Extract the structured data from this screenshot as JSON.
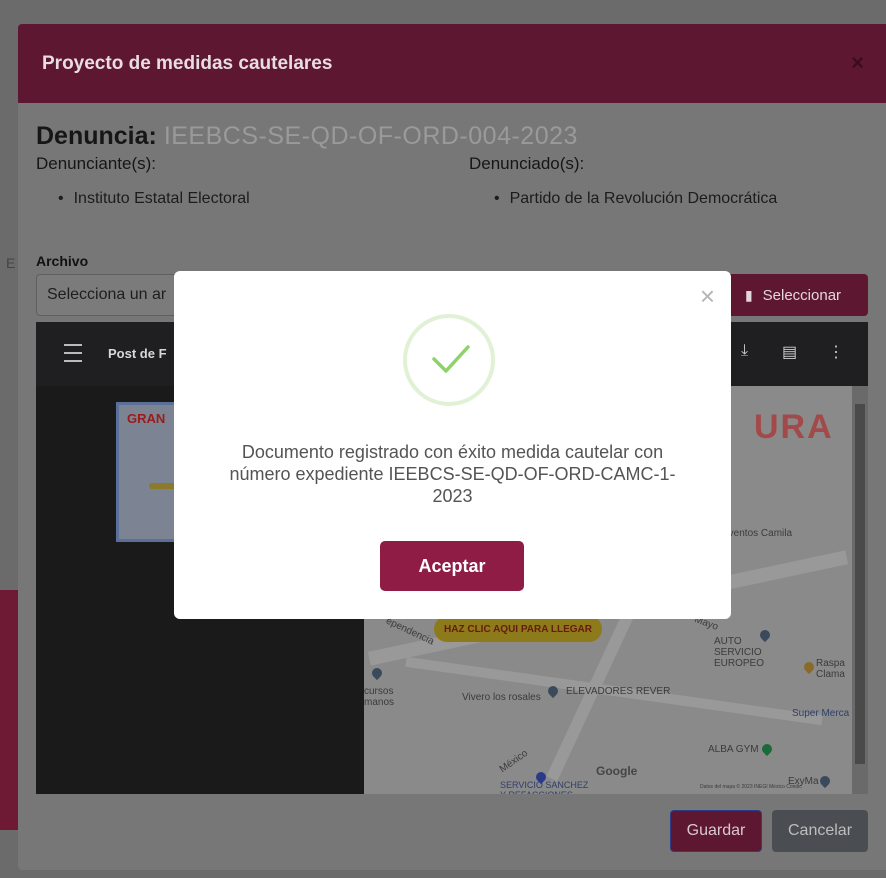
{
  "background": {
    "side_letter": "E"
  },
  "modal": {
    "title": "Proyecto de medidas cautelares",
    "close_label": "×",
    "denuncia_label": "Denuncia:",
    "denuncia_number": "IEEBCS-SE-QD-OF-ORD-004-2023",
    "denunciantes_label": "Denunciante(s):",
    "denunciantes": [
      "Instituto Estatal Electoral"
    ],
    "denunciados_label": "Denunciado(s):",
    "denunciados": [
      "Partido de la Revolución Democrática"
    ],
    "archivo_label": "Archivo",
    "file_placeholder": "Selecciona un ar",
    "select_label": "Seleccionar",
    "save_label": "Guardar",
    "cancel_label": "Cancelar"
  },
  "viewer": {
    "doc_title": "Post de F",
    "thumb_title": "GRAN",
    "map": {
      "banner": "HAZ CLIC AQUI PARA LLEGAR",
      "big_text": "URA",
      "labels": {
        "eventos": "Eventos Camila",
        "auto_servicio": "AUTO SERVICIO EUROPEO",
        "raspa": "Raspa Clama",
        "super": "Super Merca",
        "vivero": "Vivero los rosales",
        "elevadores": "ELEVADORES REVER",
        "alba": "ALBA GYM",
        "exyma": "ExyMa",
        "servicio": "SERVICIO SANCHEZ Y REFACCIONES",
        "mexico": "México",
        "mayo": "Mayo",
        "independencia": "ependencia",
        "recursos": "cursos manos",
        "google": "Google",
        "footer": "Datos del mapa © 2023 INEGI  México  Condic"
      }
    }
  },
  "dialog": {
    "close_label": "×",
    "message": "Documento registrado con éxito medida cautelar con número expediente IEEBCS-SE-QD-OF-ORD-CAMC-1-2023",
    "accept_label": "Aceptar",
    "success_color": "#7ccf5a"
  },
  "colors": {
    "brand": "#8e1c44",
    "header_dimmed": "#5e1730"
  }
}
